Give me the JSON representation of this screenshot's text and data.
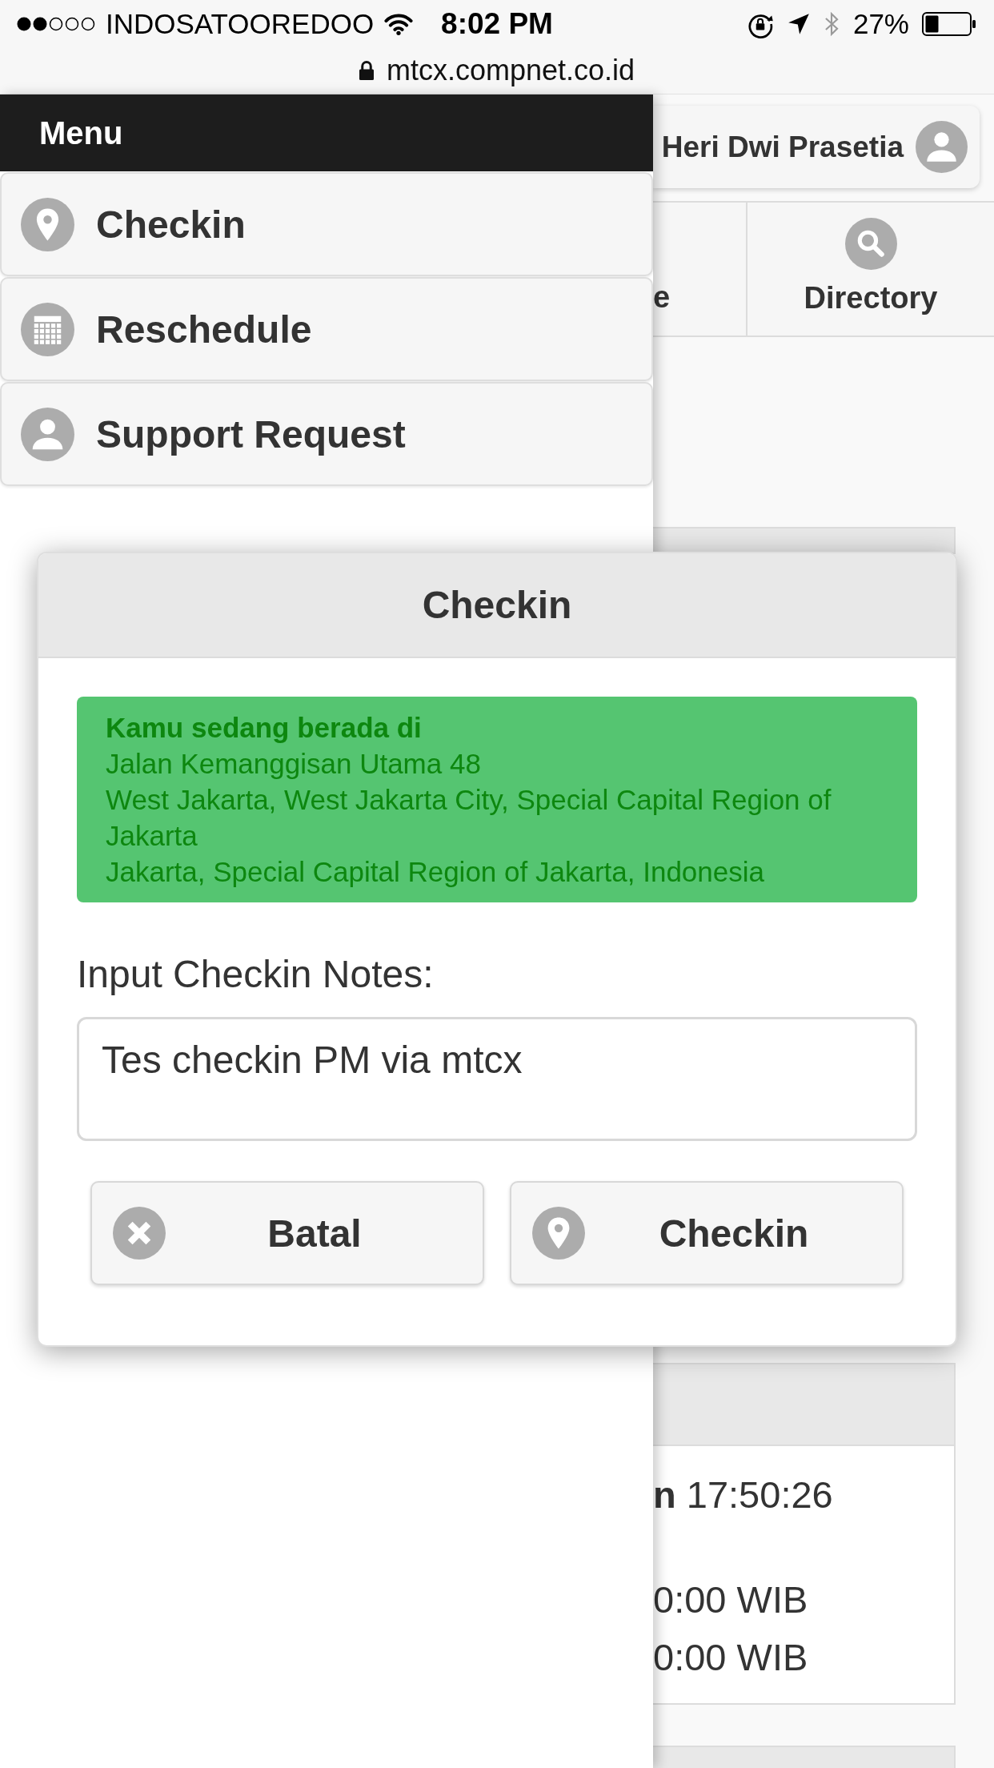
{
  "status_bar": {
    "carrier": "INDOSATOOREDOO",
    "time": "8:02 PM",
    "battery": "27%"
  },
  "address_bar": {
    "url": "mtcx.compnet.co.id"
  },
  "menu": {
    "title": "Menu",
    "items": [
      {
        "kind": "checkin",
        "label": "Checkin"
      },
      {
        "kind": "reschedule",
        "label": "Reschedule"
      },
      {
        "kind": "support",
        "label": "Support Request"
      }
    ]
  },
  "header": {
    "user_name": "Heri Dwi Prasetia"
  },
  "nav": {
    "items": [
      {
        "kind": "plain",
        "label": "e"
      },
      {
        "kind": "search",
        "label": "Directory"
      }
    ]
  },
  "background_panel": {
    "blocks": [
      {
        "lines": [
          "**n** 17:50:26"
        ]
      },
      {
        "lines": [
          "0:00 WIB",
          "0:00 WIB"
        ]
      }
    ]
  },
  "dialog": {
    "title": "Checkin",
    "alert": {
      "heading": "Kamu sedang berada di",
      "lines": [
        "Jalan Kemanggisan Utama 48",
        "West Jakarta, West Jakarta City, Special Capital Region of Jakarta",
        "Jakarta, Special Capital Region of Jakarta, Indonesia"
      ]
    },
    "notes": {
      "label": "Input Checkin Notes:",
      "value": "Tes checkin PM via mtcx"
    },
    "buttons": [
      {
        "kind": "cancel",
        "label": "Batal"
      },
      {
        "kind": "checkin",
        "label": "Checkin"
      }
    ]
  }
}
